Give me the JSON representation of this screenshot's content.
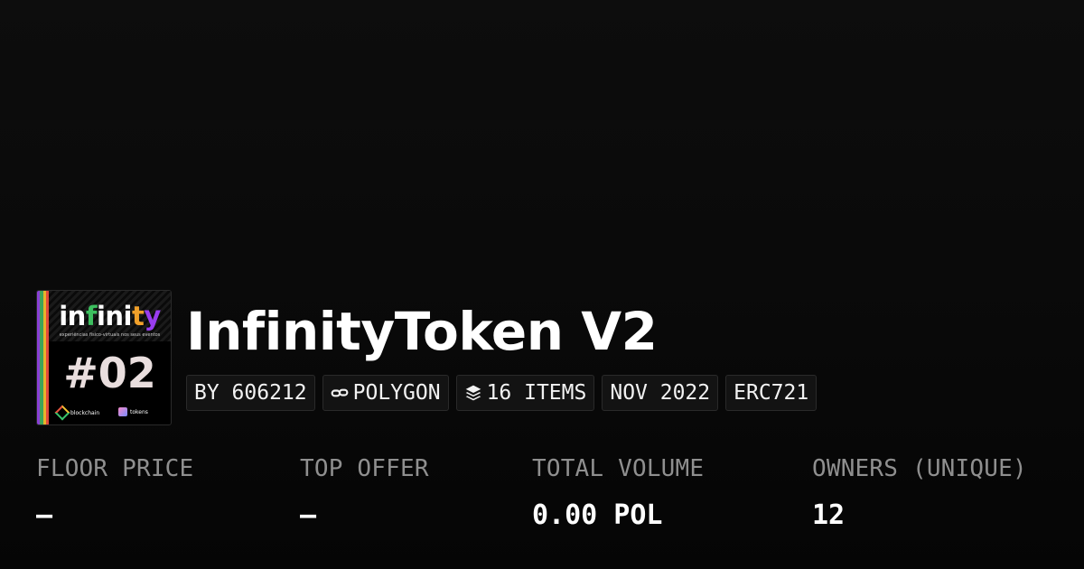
{
  "collection": {
    "name": "InfinityToken V2",
    "thumbnail": {
      "logo_letters": [
        {
          "ch": "i",
          "color": "#ffffff"
        },
        {
          "ch": "n",
          "color": "#ffffff"
        },
        {
          "ch": "f",
          "color": "#3dbf5f"
        },
        {
          "ch": "i",
          "color": "#ffffff"
        },
        {
          "ch": "n",
          "color": "#ffffff"
        },
        {
          "ch": "i",
          "color": "#ffffff"
        },
        {
          "ch": "t",
          "color": "#f0a02a"
        },
        {
          "ch": "y",
          "color": "#9a3df0"
        }
      ],
      "tagline": "experiências físico-virtuais nos seus eventos",
      "number": "#02",
      "mark_left": "blockchain",
      "mark_right": "tokens",
      "stripe_colors": [
        "#8a3fd6",
        "#3ea35a",
        "#e8b32a",
        "#e24a3c"
      ]
    }
  },
  "tags": {
    "creator": "BY 606212",
    "chain": "POLYGON",
    "items": "16 ITEMS",
    "date": "NOV 2022",
    "standard": "ERC721"
  },
  "stats": {
    "floor": {
      "label": "FLOOR PRICE",
      "value": "–"
    },
    "top_offer": {
      "label": "TOP OFFER",
      "value": "–"
    },
    "volume": {
      "label": "TOTAL VOLUME",
      "value": "0.00 POL"
    },
    "owners": {
      "label": "OWNERS (UNIQUE)",
      "value": "12"
    }
  },
  "icons": {
    "chain": "link-icon",
    "items": "layers-icon"
  }
}
